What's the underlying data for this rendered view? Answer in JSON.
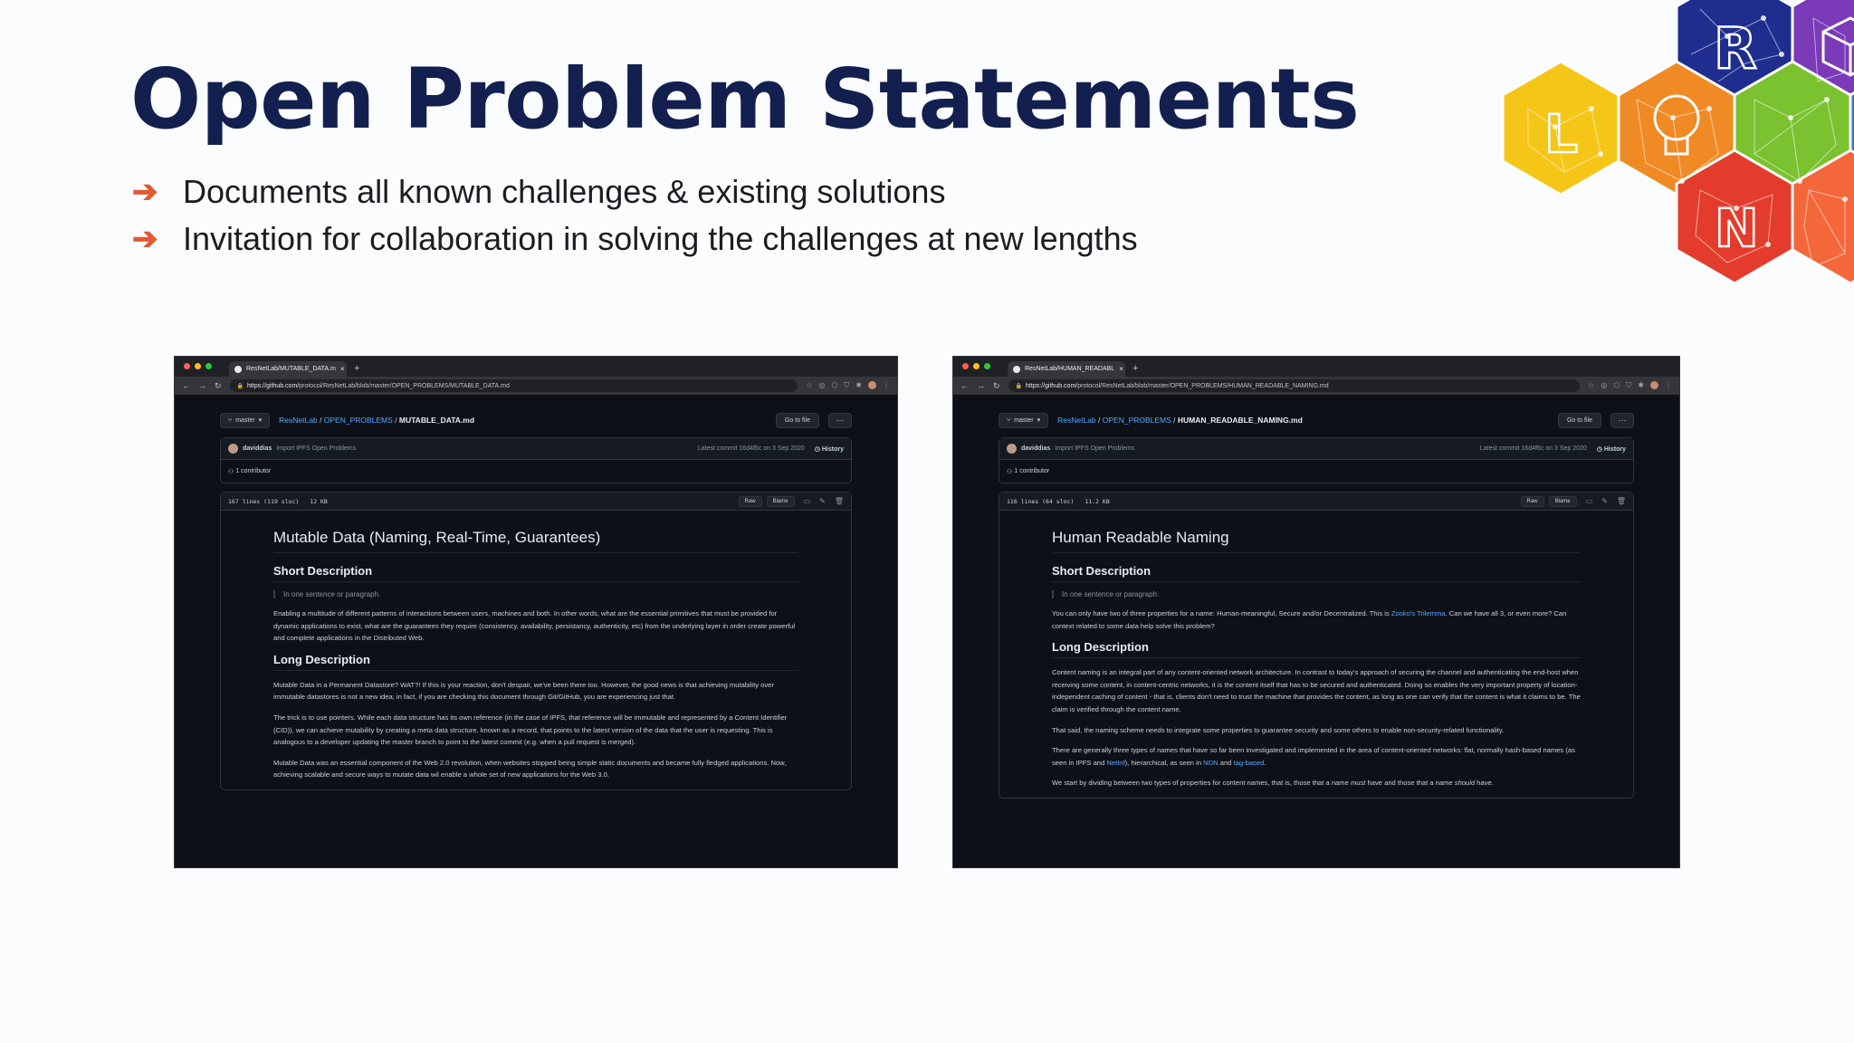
{
  "slide": {
    "title": "Open Problem Statements",
    "bullets": [
      "Documents all known challenges & existing solutions",
      "Invitation for collaboration in solving the challenges at new lengths"
    ],
    "arrow_glyph": "➔"
  },
  "colors": {
    "title": "#13204f",
    "bullet_arrow": "#e05a33",
    "page_bg": "#fbfcfe",
    "logo_cells": [
      "#1f2d8f",
      "#7b3ab8",
      "#f5c518",
      "#f08a24",
      "#7ac230",
      "#3a6fd8",
      "#e43c2c",
      "#f4673a"
    ]
  },
  "logo": {
    "letters": [
      "R",
      "L",
      "N"
    ],
    "icons": [
      "cube-icon",
      "lightbulb-icon"
    ]
  },
  "screenshots": [
    {
      "tab_title": "ResNetLab/MUTABLE_DATA.m",
      "new_tab": "+",
      "url_host": "https://github.com/",
      "url_path": "protocol/ResNetLab/blob/master/OPEN_PROBLEMS/MUTABLE_DATA.md",
      "branch": "master",
      "crumbs": {
        "org": "ResNetLab",
        "folder": "OPEN_PROBLEMS",
        "file": "MUTABLE_DATA.md",
        "sep": " / "
      },
      "go_to_file": "Go to file",
      "more": "···",
      "commit": {
        "user": "daviddias",
        "message": "Import IPFS Open Problems",
        "meta": "Latest commit 16d4f6c on 3 Sep 2020",
        "history": "History"
      },
      "contributors": "1 contributor",
      "file_stats": {
        "lines": "167 lines (119 sloc)",
        "size": "12 KB"
      },
      "file_buttons": {
        "raw": "Raw",
        "blame": "Blame"
      },
      "doc": {
        "h1": "Mutable Data (Naming, Real-Time, Guarantees)",
        "h2_short": "Short Description",
        "quote": "In one sentence or paragraph.",
        "short_p": "Enabling a multitude of different patterns of interactions between users, machines and both. In other words, what are the essential primitives that must be provided for dynamic applications to exist, what are the guarantees they require (consistency, availability, persistancy, authenticity, etc) from the underlying layer in order create powerful and complete applications in the Distributed Web.",
        "h2_long": "Long Description",
        "long_p1": "Mutable Data in a Permanent Datastore? WAT?! If this is your reaction, don't despair, we've been there too. However, the good news is that achieving mutability over immutable datastores is not a new idea; in fact, if you are checking this document through Git/GitHub, you are experiencing just that.",
        "long_p2": "The trick is to use pointers. While each data structure has its own reference (in the case of IPFS, that reference will be immutable and represented by a Content Identifier (CID)), we can achieve mutability by creating a meta data structure, known as a record, that points to the latest version of the data that the user is requesting. This is analogous to a developer updating the master branch to point to the latest commit (e.g. when a pull request is merged).",
        "long_p3": "Mutable Data was an essential component of the Web 2.0 revolution, when websites stopped being simple static documents and became fully fledged applications. Now, achieving scalable and secure ways to mutate data wil enable a whole set of new applications for the Web 3.0."
      }
    },
    {
      "tab_title": "ResNetLab/HUMAN_READABL",
      "new_tab": "+",
      "url_host": "https://github.com/",
      "url_path": "protocol/ResNetLab/blob/master/OPEN_PROBLEMS/HUMAN_READABLE_NAMING.md",
      "branch": "master",
      "crumbs": {
        "org": "ResNetLab",
        "folder": "OPEN_PROBLEMS",
        "file": "HUMAN_READABLE_NAMING.md",
        "sep": " / "
      },
      "go_to_file": "Go to file",
      "more": "···",
      "commit": {
        "user": "daviddias",
        "message": "Import IPFS Open Problems",
        "meta": "Latest commit 16d4f6c on 3 Sep 2020",
        "history": "History"
      },
      "contributors": "1 contributor",
      "file_stats": {
        "lines": "116 lines (64 sloc)",
        "size": "11.2 KB"
      },
      "file_buttons": {
        "raw": "Raw",
        "blame": "Blame"
      },
      "doc": {
        "h1": "Human Readable Naming",
        "h2_short": "Short Description",
        "quote": "In one sentence or paragraph.",
        "short_p_a": "You can only have two of three properties for a name: Human-meaningful, Secure and/or Decentralized. This is ",
        "short_link": "Zooko's Trilemma",
        "short_p_b": ". Can we have all 3, or even more? Can context related to some data help solve this problem?",
        "h2_long": "Long Description",
        "long_p1": "Content naming is an integral part of any content-oriented network architecture. In contrast to today's approach of securing the channel and authenticating the end-host when receiving some content, in content-centric networks, it is the content itself that has to be secured and authenticated. Doing so enables the very important property of location-independent caching of content - that is, clients don't need to trust the machine that provides the content, as long as one can verify that the content is what it claims to be. The claim is verified through the content name.",
        "long_p2": "That said, the naming scheme needs to integrate some properties to guarantee security and some others to enable non-security-related functionality.",
        "long_p3_a": "There are generally three types of names that have so far been investigated and implemented in the area of content-oriented networks: flat, normally hash-based names (as seen in IPFS and ",
        "long_p3_link1": "NetInf",
        "long_p3_b": "), hierarchical, as seen in ",
        "long_p3_link2": "NDN",
        "long_p3_c": " and ",
        "long_p3_link3": "tag-based",
        "long_p3_d": ".",
        "long_p4_a": "We start by dividing between two types of properties for content names, that is, those that a name ",
        "long_p4_em1": "must",
        "long_p4_b": " have and those that a name ",
        "long_p4_em2": "should",
        "long_p4_c": " have."
      }
    }
  ]
}
